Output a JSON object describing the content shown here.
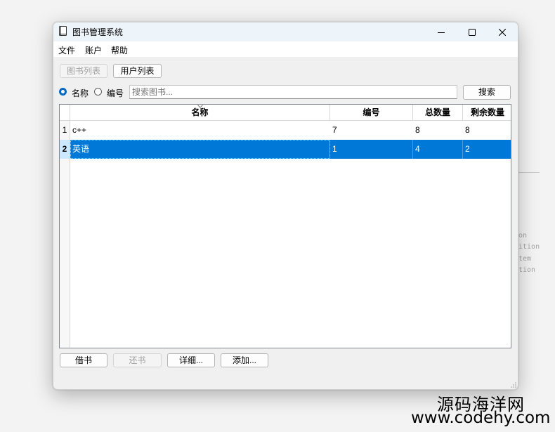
{
  "window": {
    "title": "图书管理系统"
  },
  "menu": [
    "文件",
    "账户",
    "帮助"
  ],
  "view_tabs": {
    "books": "图书列表",
    "users": "用户列表"
  },
  "search": {
    "radio_name": "名称",
    "radio_id": "编号",
    "selected": "名称",
    "placeholder": "搜索图书...",
    "value": "",
    "button": "搜索"
  },
  "table": {
    "columns": [
      "名称",
      "编号",
      "总数量",
      "剩余数量"
    ],
    "sorted_column": "名称",
    "rows": [
      {
        "num": "1",
        "cells": [
          "c++",
          "7",
          "8",
          "8"
        ]
      },
      {
        "num": "2",
        "cells": [
          "英语",
          "1",
          "4",
          "2"
        ],
        "selected": true
      }
    ]
  },
  "actions": {
    "borrow": "借书",
    "return": "还书",
    "details": "详细...",
    "add": "添加..."
  },
  "background_fragments": [
    "on",
    "ition",
    "tem",
    "tion"
  ],
  "watermark": {
    "line1": "源码海洋网",
    "line2": "www.codehy.com"
  },
  "colors": {
    "selection": "#0078d7",
    "accent": "#0067c0",
    "titlebar": "#eef5fa"
  }
}
